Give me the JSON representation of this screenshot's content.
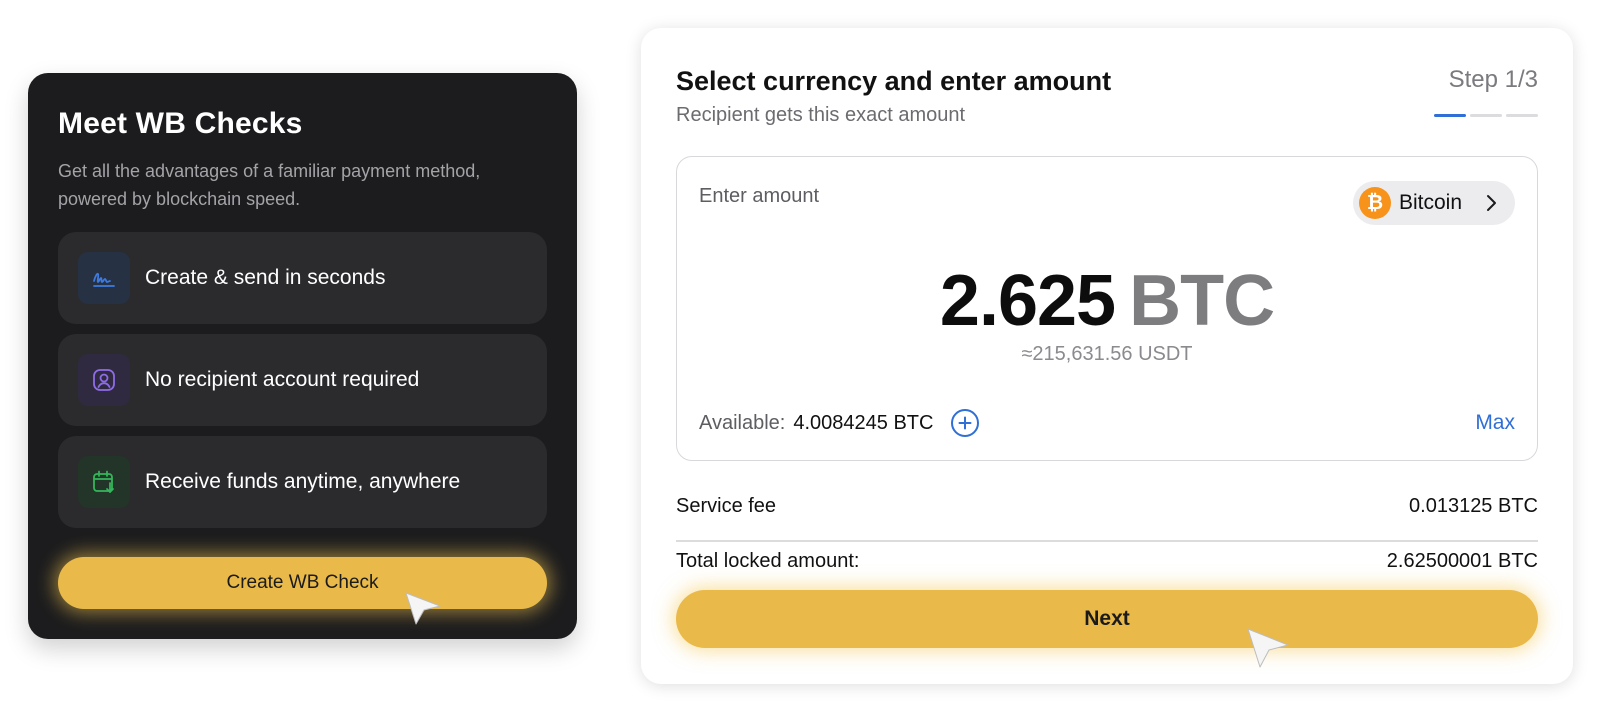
{
  "promo": {
    "title": "Meet WB Checks",
    "description": "Get all the advantages of a familiar payment method, powered by blockchain speed.",
    "features": [
      {
        "label": "Create & send in seconds",
        "icon": "signature-icon"
      },
      {
        "label": "No recipient account required",
        "icon": "user-profile-icon"
      },
      {
        "label": "Receive funds anytime, anywhere",
        "icon": "calendar-download-icon"
      }
    ],
    "cta_label": "Create WB Check"
  },
  "form": {
    "title": "Select currency and enter amount",
    "subtitle": "Recipient gets this exact amount",
    "step_label": "Step 1/3",
    "steps_total": 3,
    "step_current": 1,
    "amount_label": "Enter amount",
    "currency": {
      "name": "Bitcoin",
      "symbol": "₿",
      "icon": "bitcoin-icon",
      "color": "#f7931a"
    },
    "amount": "2.625",
    "amount_unit": "BTC",
    "approx": "≈215,631.56 USDT",
    "available_label": "Available:",
    "available_value": "4.0084245 BTC",
    "max_label": "Max",
    "fee_label": "Service fee",
    "fee_value": "0.013125 BTC",
    "total_label": "Total locked amount:",
    "total_value": "2.62500001 BTC",
    "next_label": "Next"
  },
  "colors": {
    "accent_yellow": "#e9b94a",
    "link_blue": "#2f6fd6",
    "dark_bg": "#1c1c1e",
    "bitcoin_orange": "#f7931a"
  }
}
